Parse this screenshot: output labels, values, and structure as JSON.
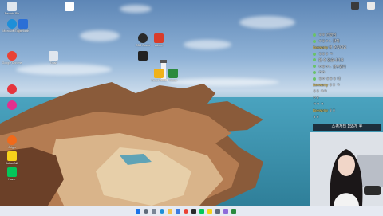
{
  "desktop_icons": [
    {
      "label": "Recycle Bin",
      "color": "#dfe6ee"
    },
    {
      "label": "Microsoft Edge",
      "color": "#1e8fd8"
    },
    {
      "label": "Bluetooth",
      "color": "#2b6fd6"
    },
    {
      "label": "",
      "color": "#ffffff"
    },
    {
      "label": "Google Chrome",
      "color": "#e94235"
    },
    {
      "label": "Trash",
      "color": "#dfe6ee"
    },
    {
      "label": "",
      "color": "#e5343d"
    },
    {
      "label": "",
      "color": "#e2308e"
    },
    {
      "label": "Origin",
      "color": "#f06a1b"
    },
    {
      "label": "KakaoTalk",
      "color": "#f7d21b"
    },
    {
      "label": "Naver",
      "color": "#03c75a"
    },
    {
      "label": "OBS Studio",
      "color": "#2a2a2a"
    },
    {
      "label": "Adobe",
      "color": "#d93c2a"
    },
    {
      "label": "",
      "color": "#222222"
    },
    {
      "label": "Smart Stock",
      "color": "#f0b21a"
    },
    {
      "label": "Vtuber",
      "color": "#2b8a3e"
    }
  ],
  "chat": {
    "messages": [
      {
        "user": "",
        "text": "ㅎㅎ 선생님"
      },
      {
        "user": "",
        "text": "ㅇㅎㅇㄴ 잘해"
      },
      {
        "user": "Beewerry",
        "text": "할 수있어요"
      },
      {
        "user": "",
        "text": "ㅎㅎㅎ ㅋ"
      },
      {
        "user": "",
        "text": "할 수 있습니다요"
      },
      {
        "user": "",
        "text": "ㅇㅎㅇㄴ 할수있다"
      },
      {
        "user": "",
        "text": "ㅇㅇ"
      },
      {
        "user": "",
        "text": "ㅎㅇ ㅎㅎㅎ 다"
      },
      {
        "user": "Beewerry",
        "text": "ㅎㅎ ㅋ"
      },
      {
        "user": "",
        "text": "ㅎㅎ ㅋㅋ"
      },
      {
        "user": "",
        "text": "ㅇㅎ"
      },
      {
        "user": "",
        "text": "ㅋㅋ ㅋ"
      },
      {
        "user": "Beewerry",
        "text": "ㅎㅎ"
      },
      {
        "user": "",
        "text": "ㅎㅎ"
      },
      {
        "user": "",
        "text": "ㅎㅇ"
      }
    ],
    "banner": "스퀴게티 155개 후"
  },
  "taskbar": {
    "icons": [
      "start-icon",
      "search-icon",
      "task-view-icon",
      "edge-icon",
      "explorer-icon",
      "store-icon",
      "chrome-icon",
      "mail-icon",
      "obs-icon",
      "kakao-icon"
    ],
    "colors": {
      "start": "#1a73e8",
      "search": "#5f6b7a",
      "edge": "#1e8fd8",
      "explorer": "#f2c14e",
      "chrome": "#e94235",
      "green": "#03c75a"
    }
  }
}
